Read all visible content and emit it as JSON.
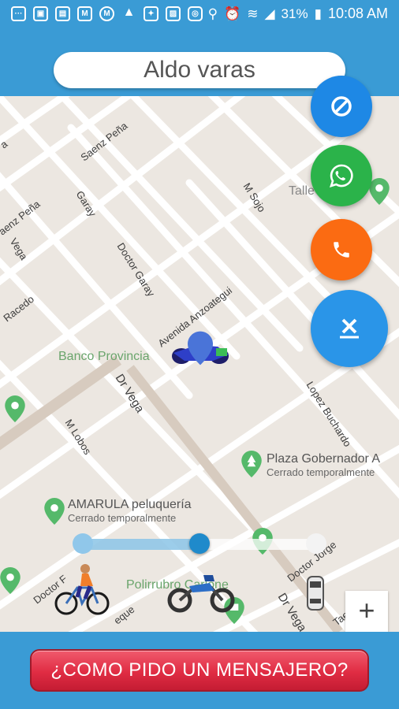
{
  "status_bar": {
    "battery": "31%",
    "time": "10:08 AM",
    "left_icons": [
      "more-icon",
      "gallery-icon",
      "shop-icon",
      "gmail-icon",
      "mail-icon",
      "nav-icon",
      "photos-icon",
      "image-icon",
      "instagram-icon"
    ],
    "right_icons": [
      "location-icon",
      "alarm-icon",
      "wifi-icon",
      "signal-icon",
      "battery-icon"
    ]
  },
  "header": {
    "user_name": "Aldo varas"
  },
  "map": {
    "streets": {
      "saenz_pena_1": "Saenz Peña",
      "saenz_pena_2": "aenz Peña",
      "garay": "Garay",
      "m_sojo": "M Sojo",
      "vega": "Vega",
      "doctor_garay": "Doctor Garay",
      "racedo": "Racedo",
      "avenida_anzoategui": "Avenida Anzoategui",
      "dr_vega_1": "Dr Vega",
      "m_lobos": "M Lobos",
      "lopez_buchardo": "Lopez Buchardo",
      "doctor_jorge": "Doctor Jorge",
      "doctor_f": "Doctor F",
      "dr_vega_2": "Dr Vega",
      "ta_left": "a",
      "eque": "eque",
      "tae": "Tae"
    },
    "pois": {
      "taller": "Talle",
      "banco": "Banco Provincia",
      "plaza_name": "Plaza Gobernador A",
      "plaza_status": "Cerrado temporalmente",
      "amarula_name": "AMARULA peluquería",
      "amarula_status": "Cerrado temporalmente",
      "polirrubro": "Polirrubro Carlone"
    },
    "slider": {
      "value": 0.5
    },
    "zoom_in_label": "+"
  },
  "fabs": {
    "block": "block-icon",
    "whatsapp": "whatsapp-icon",
    "call": "phone-icon",
    "cancel": "cancel-icon"
  },
  "bottom": {
    "request_button_label": "¿COMO PIDO UN MENSAJERO?"
  },
  "colors": {
    "primary": "#3a9bd5",
    "block_fab": "#1e88e5",
    "whatsapp_fab": "#2bb34a",
    "call_fab": "#fb6b12",
    "cancel_fab": "#2a95e8",
    "request_button": "#e02c43",
    "poi_green": "#6aa56c"
  }
}
